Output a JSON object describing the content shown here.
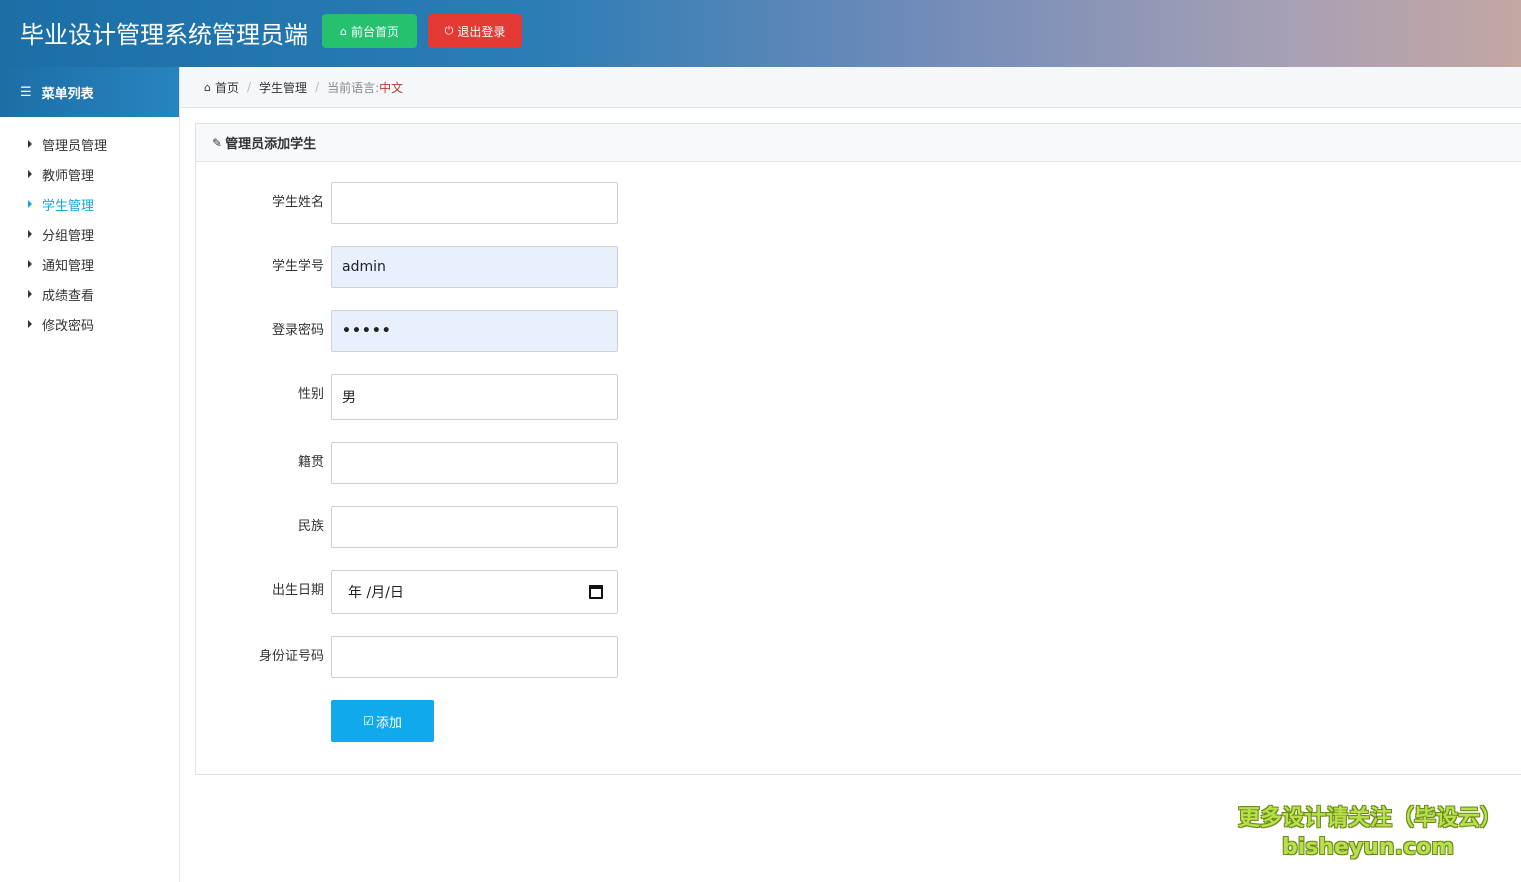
{
  "header": {
    "title": "毕业设计管理系统管理员端",
    "home_button": "前台首页",
    "logout_button": "退出登录"
  },
  "sidebar": {
    "menu_title": "菜单列表",
    "items": [
      {
        "label": "管理员管理",
        "active": false
      },
      {
        "label": "教师管理",
        "active": false
      },
      {
        "label": "学生管理",
        "active": true
      },
      {
        "label": "分组管理",
        "active": false
      },
      {
        "label": "通知管理",
        "active": false
      },
      {
        "label": "成绩查看",
        "active": false
      },
      {
        "label": "修改密码",
        "active": false
      }
    ]
  },
  "breadcrumb": {
    "home": "首页",
    "section": "学生管理",
    "lang_label": "当前语言:",
    "lang_value": "中文"
  },
  "panel": {
    "title": "管理员添加学生"
  },
  "form": {
    "name_label": "学生姓名",
    "name_value": "",
    "id_label": "学生学号",
    "id_value": "admin",
    "password_label": "登录密码",
    "password_value": "•••••",
    "gender_label": "性别",
    "gender_value": "男",
    "native_label": "籍贯",
    "native_value": "",
    "ethnic_label": "民族",
    "ethnic_value": "",
    "birth_label": "出生日期",
    "birth_placeholder": "年 /月/日",
    "idcard_label": "身份证号码",
    "idcard_value": "",
    "submit_label": "添加"
  },
  "watermark": {
    "line1": "更多设计请关注（毕设云）",
    "line2": "bisheyun.com"
  },
  "colors": {
    "header_start": "#1b6fa6",
    "green_button": "#25c16f",
    "red_button": "#e33a35",
    "active_menu": "#1aa3d8",
    "submit_button": "#10a9ec",
    "lang_value": "#c0392b"
  }
}
